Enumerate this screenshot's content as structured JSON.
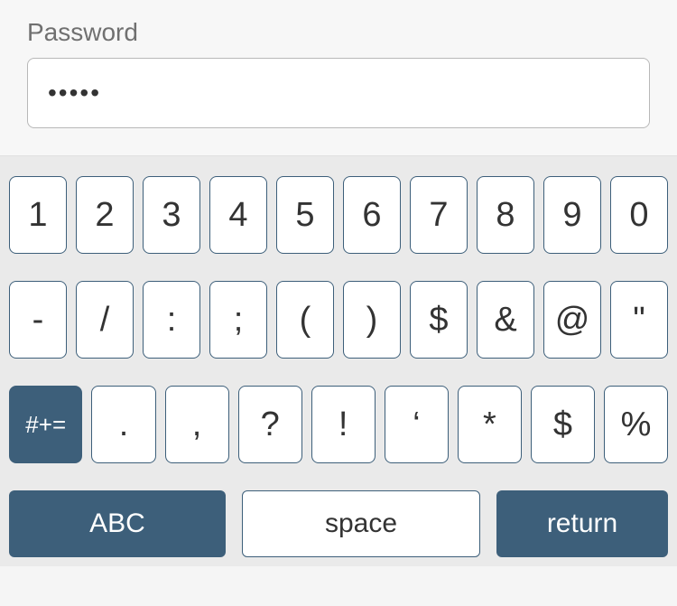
{
  "form": {
    "label": "Password",
    "masked_value": "•••••"
  },
  "keyboard": {
    "row1": [
      "1",
      "2",
      "3",
      "4",
      "5",
      "6",
      "7",
      "8",
      "9",
      "0"
    ],
    "row2": [
      "-",
      "/",
      ":",
      ";",
      "(",
      ")",
      "$",
      "&",
      "@",
      "\""
    ],
    "row3_modifier": "#+=",
    "row3": [
      ".",
      ",",
      "?",
      "!",
      "‘",
      "*",
      "$",
      "%"
    ],
    "abc": "ABC",
    "space": "space",
    "return": "return"
  }
}
